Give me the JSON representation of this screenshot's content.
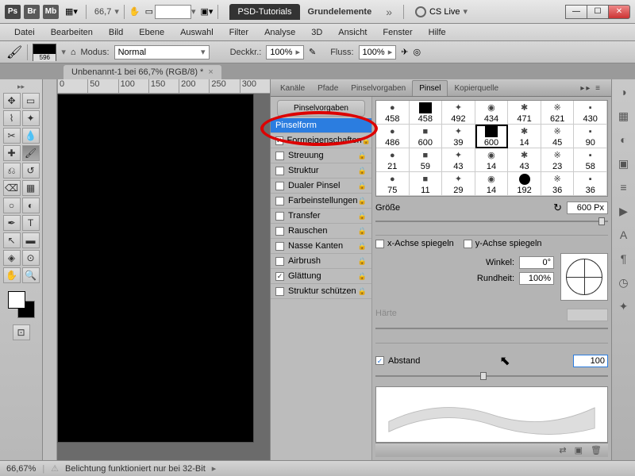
{
  "titlebar": {
    "ps": "Ps",
    "br": "Br",
    "mb": "Mb",
    "zoom": "66,7",
    "tab_dark": "PSD-Tutorials",
    "tab_light": "Grundelemente",
    "cslive": "CS Live"
  },
  "menu": [
    "Datei",
    "Bearbeiten",
    "Bild",
    "Ebene",
    "Auswahl",
    "Filter",
    "Analyse",
    "3D",
    "Ansicht",
    "Fenster",
    "Hilfe"
  ],
  "options": {
    "swatch": "596",
    "mode_label": "Modus:",
    "mode": "Normal",
    "opac_label": "Deckkr.:",
    "opac": "100%",
    "flow_label": "Fluss:",
    "flow": "100%"
  },
  "doc_tab": "Unbenannt-1 bei 66,7% (RGB/8) *",
  "ruler": [
    "0",
    "50",
    "100",
    "150",
    "200",
    "250",
    "300"
  ],
  "panel_tabs": [
    "Kanäle",
    "Pfade",
    "Pinselvorgaben",
    "Pinsel",
    "Kopierquelle"
  ],
  "brush_hdr": "Pinselvorgaben",
  "brush_items": [
    {
      "label": "Pinselform",
      "sel": true,
      "cb": false
    },
    {
      "label": "Formeigenschaften",
      "cb": true,
      "checked": true,
      "lock": true
    },
    {
      "label": "Streuung",
      "cb": true,
      "lock": true
    },
    {
      "label": "Struktur",
      "cb": true,
      "lock": true
    },
    {
      "label": "Dualer Pinsel",
      "cb": true,
      "lock": true
    },
    {
      "label": "Farbeinstellungen",
      "cb": true,
      "lock": true
    },
    {
      "label": "Transfer",
      "cb": true,
      "lock": true
    },
    {
      "label": "Rauschen",
      "cb": true,
      "lock": true
    },
    {
      "label": "Nasse Kanten",
      "cb": true,
      "lock": true
    },
    {
      "label": "Airbrush",
      "cb": true,
      "lock": true
    },
    {
      "label": "Glättung",
      "cb": true,
      "checked": true,
      "lock": true
    },
    {
      "label": "Struktur schützen",
      "cb": true,
      "lock": true
    }
  ],
  "brush_sizes": [
    "458",
    "458",
    "492",
    "434",
    "471",
    "621",
    "430",
    "486",
    "600",
    "39",
    "600",
    "14",
    "45",
    "90",
    "21",
    "59",
    "43",
    "14",
    "43",
    "23",
    "58",
    "75",
    "11",
    "29",
    "14",
    "192",
    "36",
    "36"
  ],
  "brush_sel_index": 10,
  "size_label": "Größe",
  "size_val": "600 Px",
  "flipx": "x-Achse spiegeln",
  "flipy": "y-Achse spiegeln",
  "angle_label": "Winkel:",
  "angle": "0°",
  "round_label": "Rundheit:",
  "round": "100%",
  "hard_label": "Härte",
  "spacing_label": "Abstand",
  "spacing": "100",
  "status_zoom": "66,67%",
  "status_msg": "Belichtung funktioniert nur bei 32-Bit"
}
